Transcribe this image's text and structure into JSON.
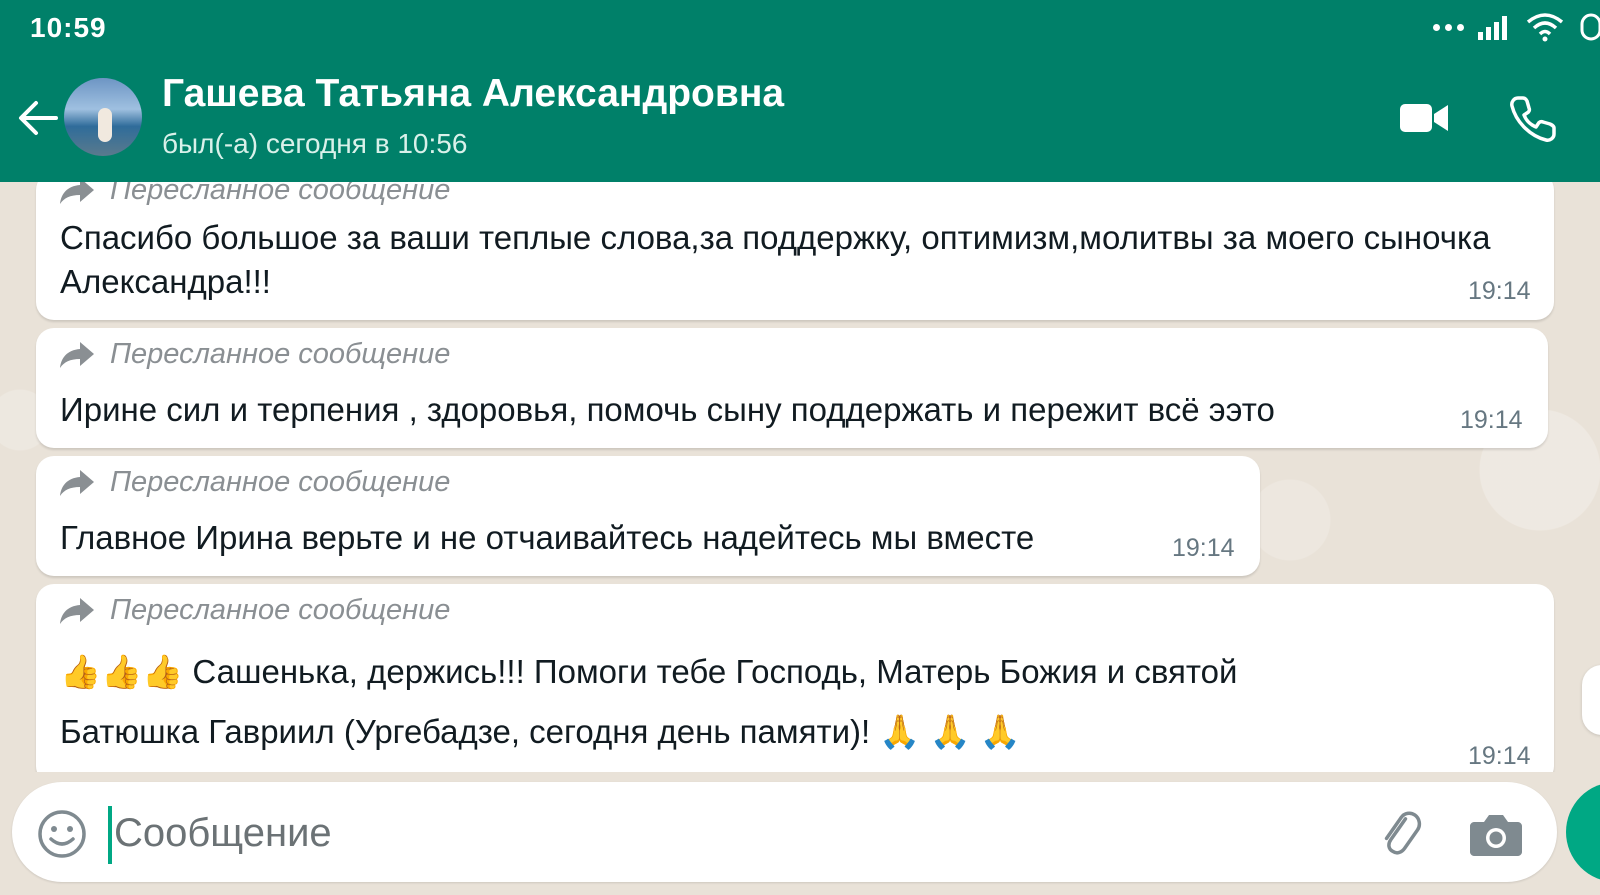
{
  "status_bar": {
    "time": "10:59"
  },
  "header": {
    "contact_name": "Гашева Татьяна Александровна",
    "last_seen": "был(-а) сегодня в 10:56"
  },
  "messages": [
    {
      "forwarded_label": "Пересланное сообщение",
      "text": "Спасибо большое за  ваши теплые слова,за поддержку, оптимизм,молитвы за моего сыночка Александра!!!",
      "time": "19:14"
    },
    {
      "forwarded_label": "Пересланное сообщение",
      "text": "Ирине сил и терпения  , здоровья, помочь сыну поддержать и пережит всё ээто",
      "time": "19:14"
    },
    {
      "forwarded_label": "Пересланное сообщение",
      "text": "Главное Ирина верьте и не отчаивайтесь надейтесь мы вместе",
      "time": "19:14"
    },
    {
      "forwarded_label": "Пересланное сообщение",
      "text_line1": "👍👍👍 Сашенька, держись!!! Помоги тебе Господь, Матерь Божия и святой",
      "text_line2": "Батюшка Гавриил (Ургебадзе, сегодня день памяти)! 🙏 🙏 🙏",
      "time": "19:14"
    }
  ],
  "composer": {
    "placeholder": "Сообщение"
  },
  "icons": {
    "back": "arrow-left-icon",
    "video": "video-camera-icon",
    "call": "phone-icon",
    "forward": "forward-arrow-icon",
    "emoji": "smiley-icon",
    "attach": "paperclip-icon",
    "camera": "camera-icon"
  },
  "colors": {
    "header": "#008069",
    "accent": "#00a884",
    "bubble": "#ffffff",
    "background": "#E9E2D8"
  }
}
